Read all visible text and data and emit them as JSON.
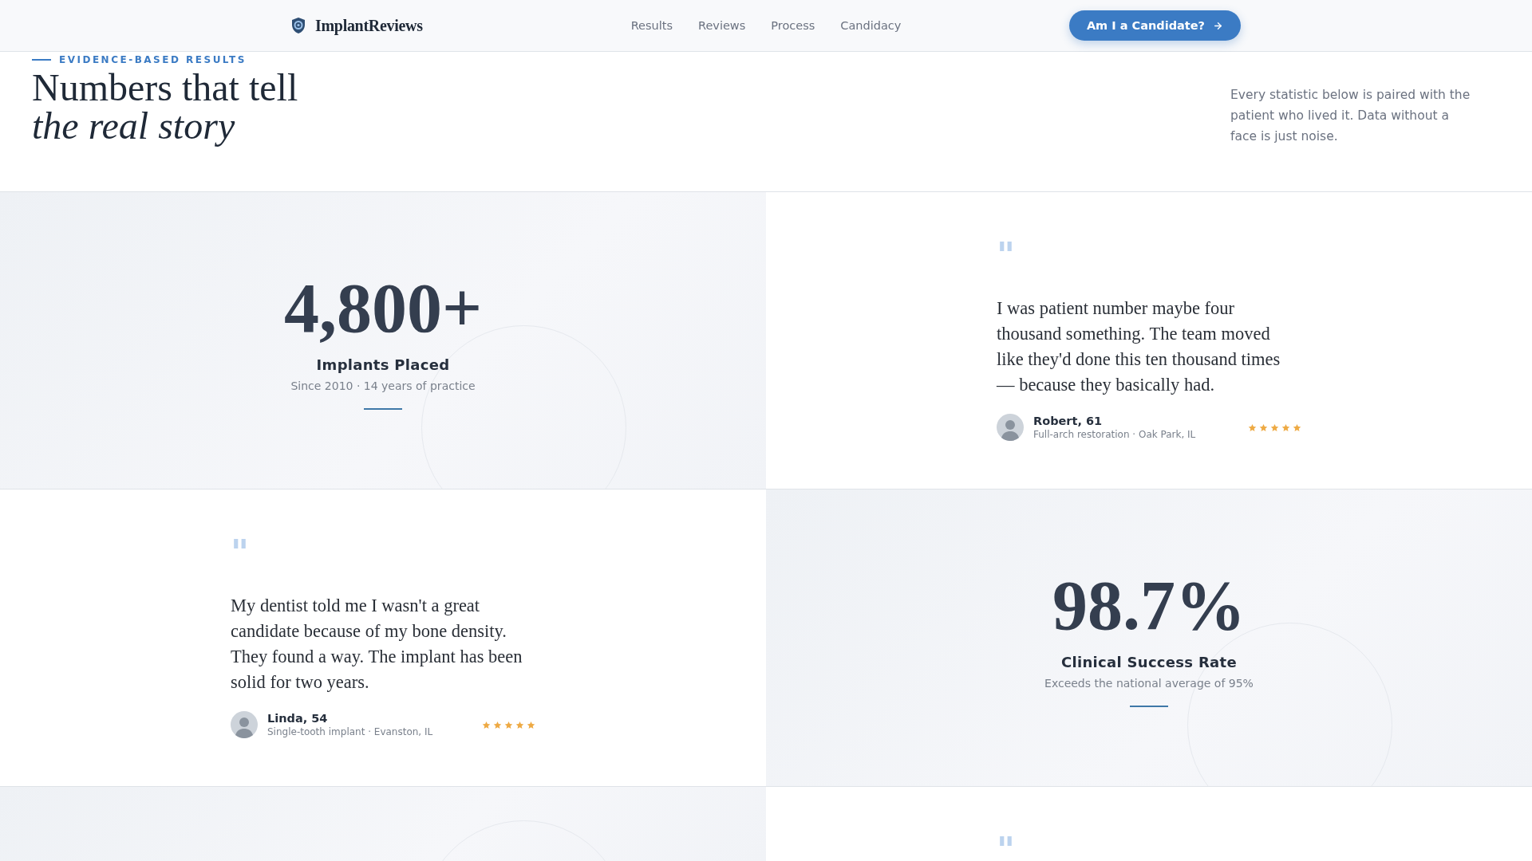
{
  "header": {
    "brand": "ImplantReviews",
    "nav": [
      "Results",
      "Reviews",
      "Process",
      "Candidacy"
    ],
    "cta": "Am I a Candidate?"
  },
  "hero": {
    "eyebrow": "EVIDENCE-BASED RESULTS",
    "title_lines": [
      {
        "text": "Numbers that tell",
        "italic": false
      },
      {
        "text": "the real story",
        "italic": true
      }
    ],
    "intro": "Every statistic below is paired with the patient who lived it. Data without a face is just noise."
  },
  "rows": [
    {
      "cells": [
        {
          "kind": "stat",
          "value": "4,800+",
          "label": "Implants Placed",
          "note": "Since 2010 · 14 years of practice"
        },
        {
          "kind": "testimonial",
          "mark": "\"",
          "quote": "I was patient number maybe four thousand something. The team moved like they'd done this ten thousand times — because they basically had.",
          "name": "Robert, 61",
          "detail": "Full-arch restoration · Oak Park, IL",
          "stars": 5
        }
      ]
    },
    {
      "cells": [
        {
          "kind": "testimonial",
          "mark": "\"",
          "quote": "My dentist told me I wasn't a great candidate because of my bone density. They found a way. The implant has been solid for two years.",
          "name": "Linda, 54",
          "detail": "Single-tooth implant · Evanston, IL",
          "stars": 5
        },
        {
          "kind": "stat",
          "value": "98.7%",
          "label": "Clinical Success Rate",
          "note": "Exceeds the national average of 95%"
        }
      ]
    },
    {
      "cells": [
        {
          "kind": "stat"
        },
        {
          "kind": "testimonial",
          "mark": "\""
        }
      ]
    }
  ]
}
